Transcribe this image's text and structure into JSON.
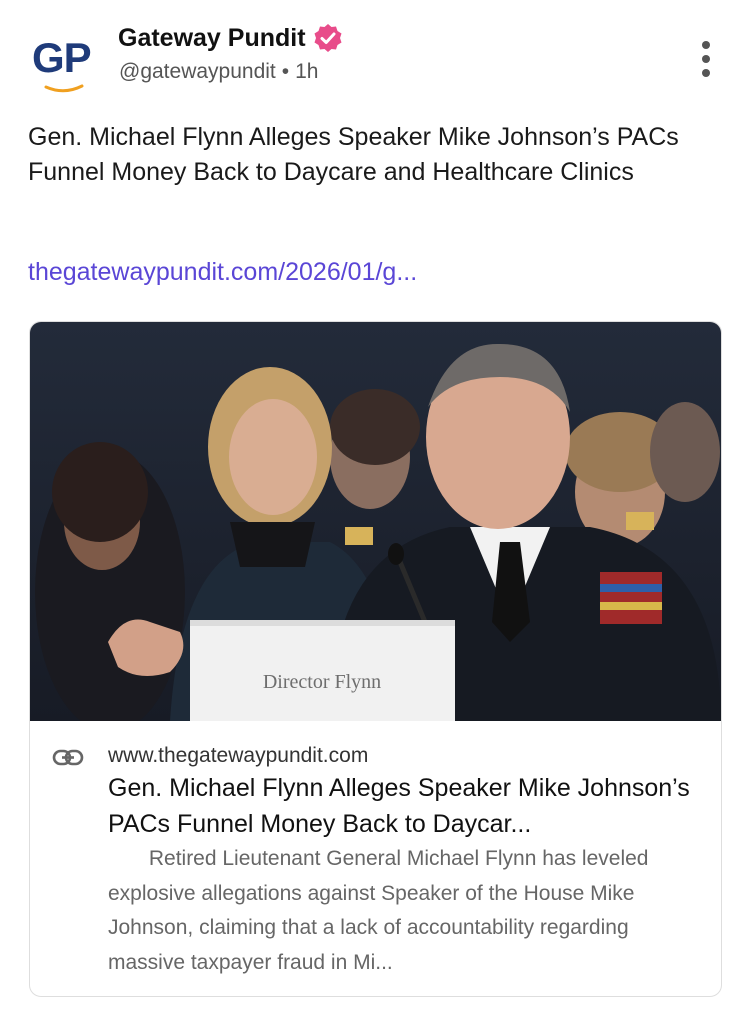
{
  "post": {
    "author_name": "Gateway Pundit",
    "avatar_initials": "GP",
    "handle": "@gatewaypundit",
    "separator": "•",
    "time_ago": "1h",
    "text": "Gen. Michael Flynn Alleges Speaker Mike Johnson’s PACs Funnel Money Back to Daycare and Healthcare Clinics",
    "link_text": "thegatewaypundit.com/2026/01/g...",
    "verified": true
  },
  "card": {
    "image_nameplate": "Director Flynn",
    "domain": "www.thegatewaypundit.com",
    "title": "Gen. Michael Flynn Alleges Speaker Mike Johnson’s PACs Funnel Money Back to Daycar...",
    "description": "       Retired Lieutenant General Michael Flynn has leveled explosive allegations against Speaker of the House Mike Johnson, claiming that a lack of accountability regarding massive taxpayer fraud in Mi..."
  },
  "icons": {
    "verified": "verified-badge-icon",
    "more": "more-vertical-icon",
    "link": "link-icon"
  },
  "colors": {
    "link": "#5a46d6",
    "verified_badge": "#e84c8a",
    "avatar_text": "#1f3b7a",
    "avatar_swoosh": "#f0a020"
  }
}
